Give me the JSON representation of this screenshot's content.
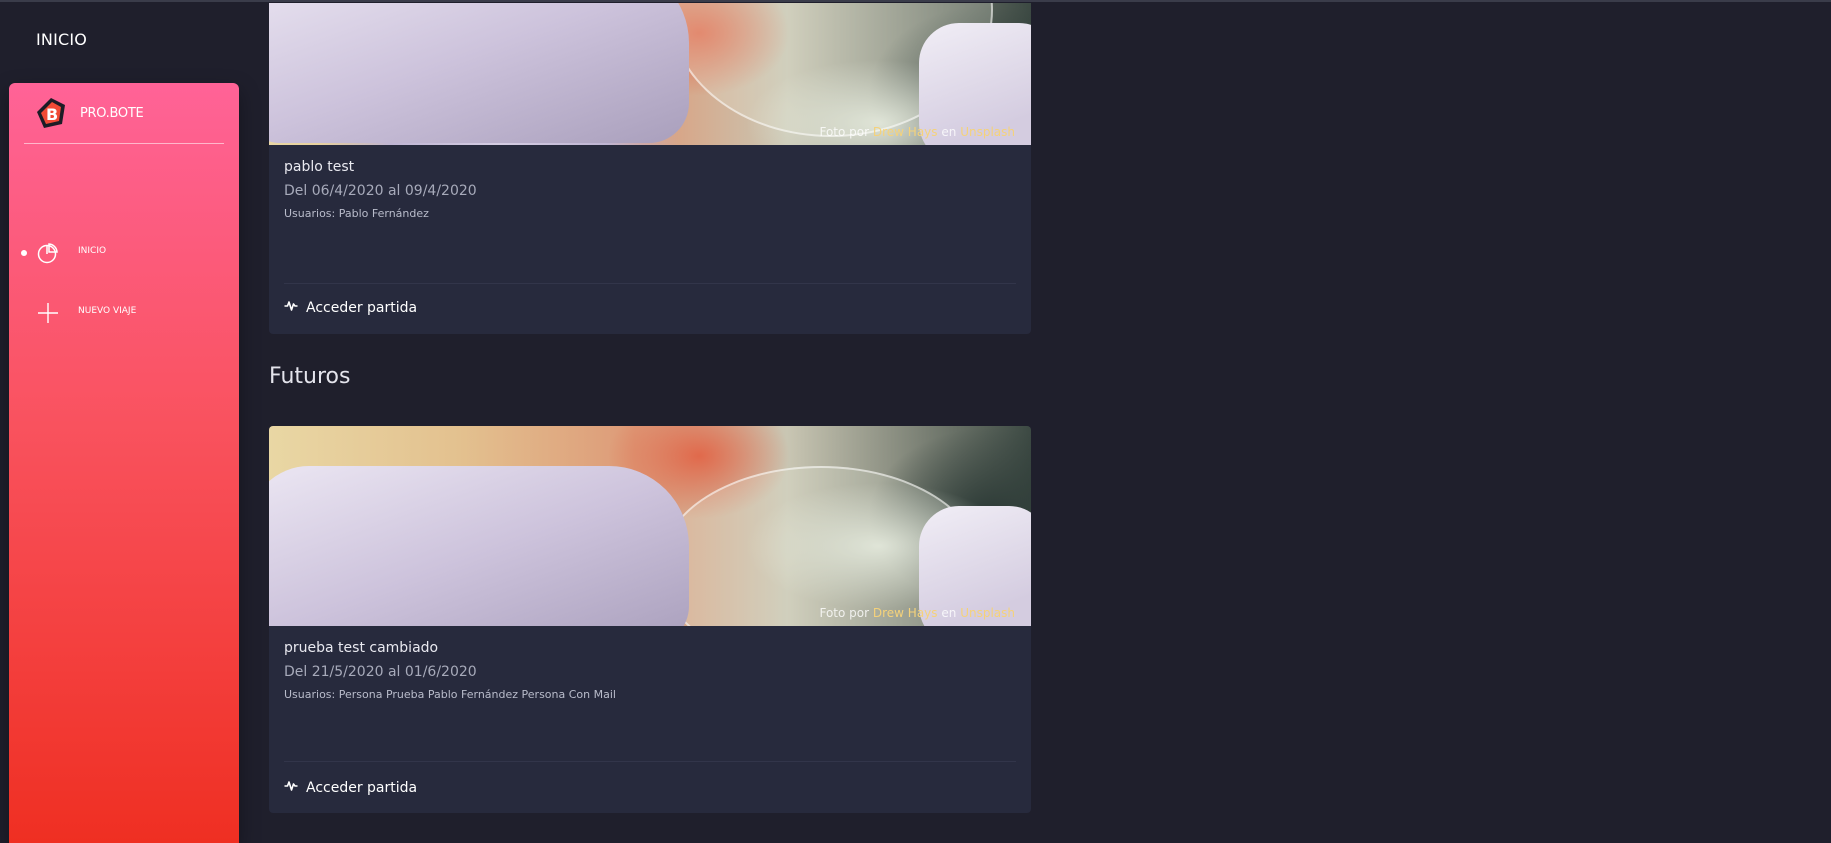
{
  "header": {
    "title": "INICIO"
  },
  "sidebar": {
    "brand": "PRO.BOTE",
    "items": [
      {
        "label": "INICIO",
        "icon": "pie-chart-icon",
        "active": true
      },
      {
        "label": "NUEVO VIAJE",
        "icon": "plus-icon",
        "active": false
      }
    ]
  },
  "trips": {
    "current": {
      "title": "pablo test",
      "dates": "Del 06/4/2020 al 09/4/2020",
      "users": "Usuarios: Pablo Fernández",
      "action": "Acceder partida",
      "credit": {
        "prefix": "Foto por",
        "author": "Drew Hays",
        "middle": "en",
        "site": "Unsplash"
      }
    },
    "future_section_title": "Futuros",
    "future": {
      "title": "prueba test cambiado",
      "dates": "Del 21/5/2020 al 01/6/2020",
      "users": "Usuarios: Persona Prueba Pablo Fernández Persona Con Mail",
      "action": "Acceder partida",
      "credit": {
        "prefix": "Foto por",
        "author": "Drew Hays",
        "middle": "en",
        "site": "Unsplash"
      }
    }
  },
  "colors": {
    "sidebar_top": "#ff6397",
    "sidebar_bottom": "#ef2f22",
    "background": "#1f1f2c",
    "card": "#272a3d",
    "credit_highlight": "#f5d27a"
  }
}
